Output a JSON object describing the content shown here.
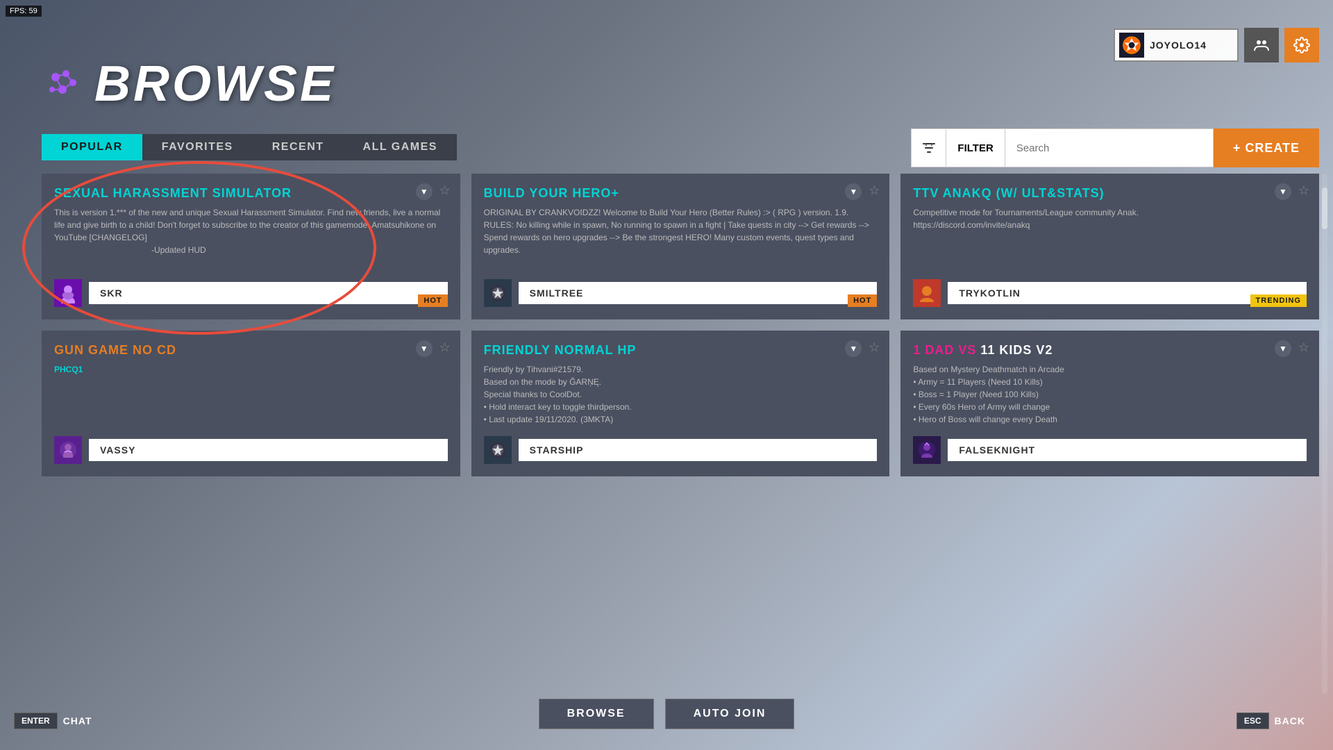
{
  "fps": {
    "label": "FPS:",
    "value": "59"
  },
  "user": {
    "name": "JOYOLO14"
  },
  "header": {
    "title": "BROWSE"
  },
  "tabs": [
    {
      "label": "POPULAR",
      "active": true
    },
    {
      "label": "FAVORITES",
      "active": false
    },
    {
      "label": "RECENT",
      "active": false
    },
    {
      "label": "ALL GAMES",
      "active": false
    }
  ],
  "toolbar": {
    "filter_label": "FILTER",
    "search_placeholder": "Search",
    "create_label": "+ CREATE"
  },
  "cards": [
    {
      "id": "card1",
      "title": "SEXUAL HARASSMENT SIMULATOR",
      "title_color": "cyan",
      "description": "This is version 1.*** of the new and unique Sexual Harassment Simulator. Find new friends, live a normal life and give birth to a child! Don't forget to subscribe to the creator of this gamemode: Amatsuhikone on YouTube [CHANGELOG]\n-Updated HUD",
      "player_name": "SKR",
      "player_avatar_color": "purple",
      "badge": "HOT",
      "badge_color": "orange",
      "highlighted": true
    },
    {
      "id": "card2",
      "title": "BUILD YOUR HERO+",
      "title_color": "cyan",
      "description": "ORIGINAL BY CRANKVOIDZZ! Welcome to Build Your Hero (Better Rules) :> ( RPG ) version. 1.9. RULES: No killing while in spawn, No running to spawn in a fight | Take quests in city --> Get rewards --> Spend rewards on hero upgrades --> Be the strongest HERO! Many custom events, quest types and upgrades.",
      "player_name": "SMILTREE",
      "player_avatar_color": "default",
      "badge": "HOT",
      "badge_color": "orange",
      "highlighted": false
    },
    {
      "id": "card3",
      "title": "TTV ANAKQ (W/ ULT&STATS)",
      "title_color": "cyan",
      "description": "Competitive mode for Tournaments/League community Anak.\nhttps://discord.com/invite/anakq",
      "player_name": "TRYKOTLIN",
      "player_avatar_color": "orange-bg",
      "badge": "TRENDING",
      "badge_color": "trending",
      "highlighted": false
    },
    {
      "id": "card4",
      "title": "GUN GAME NO CD",
      "title_color": "orange",
      "description": "PHCQ1",
      "player_name": "VASSY",
      "player_avatar_color": "dark-purple",
      "badge": null,
      "highlighted": false
    },
    {
      "id": "card5",
      "title": "FRIENDLY NORMAL HP",
      "title_color": "cyan",
      "description": "Friendly by Tihvani#21579.\nBased on the mode by ĞARŅĘ.\nSpecial thanks to CoolDot.\n• Hold interact key to toggle thirdperson.\n• Last update  19/11/2020. (3MKTA)",
      "player_name": "STARSHIP",
      "player_avatar_color": "default",
      "badge": null,
      "highlighted": false
    },
    {
      "id": "card6",
      "title": "1 DAD VS 11 KIDS V2",
      "title_color": "pink",
      "description": "Based on Mystery Deathmatch in Arcade\n• Army = 11 Players (Need 10 Kills)\n• Boss = 1 Player (Need 100 Kills)\n• Every 60s Hero of Army will change\n• Hero of Boss will change every Death",
      "player_name": "FALSEKNIGHT",
      "player_avatar_color": "dark-purple",
      "badge": null,
      "highlighted": false
    }
  ],
  "bottom": {
    "enter_key": "ENTER",
    "chat_label": "CHAT",
    "browse_btn": "BROWSE",
    "autojoin_btn": "AUTO JOIN",
    "esc_key": "ESC",
    "back_label": "BACK"
  }
}
